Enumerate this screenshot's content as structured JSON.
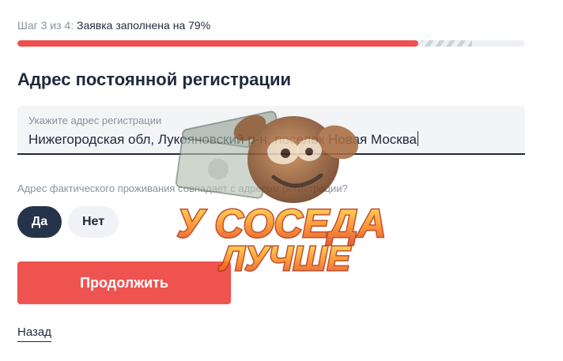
{
  "progress": {
    "step_prefix": "Шаг 3 из 4:",
    "step_text": "Заявка заполнена на 79%",
    "percent": 79,
    "colors": {
      "fill": "#ef4f4f",
      "track": "#eef0f3"
    }
  },
  "section": {
    "title": "Адрес постоянной регистрации"
  },
  "address_field": {
    "label": "Укажите адрес регистрации",
    "value": "Нижегородская обл, Лукояновский р-н, поселок Новая Москва"
  },
  "same_address": {
    "question": "Адрес фактического проживания совпадает с адресом регистрации?",
    "options": [
      {
        "label": "Да",
        "selected": true
      },
      {
        "label": "Нет",
        "selected": false
      }
    ]
  },
  "actions": {
    "continue_label": "Продолжить",
    "back_label": "Назад"
  },
  "overlay": {
    "line1": "У СОСЕДА",
    "line2": "ЛУЧШЕ"
  },
  "colors": {
    "primary_dark": "#25344a",
    "accent_red": "#ef5350"
  }
}
